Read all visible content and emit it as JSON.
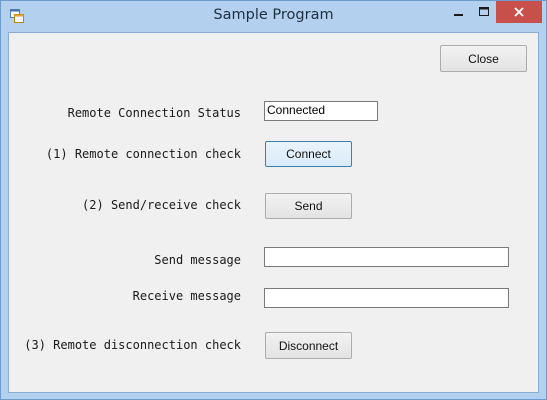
{
  "window": {
    "title": "Sample Program",
    "icon": "app-icon",
    "controls": {
      "minimize": "minimize-icon",
      "maximize": "maximize-icon",
      "close": "close-icon"
    }
  },
  "form": {
    "close_button": "Close",
    "remote_status_label": "Remote Connection Status",
    "remote_status_value": "Connected",
    "connection_check_label": "(1) Remote connection check",
    "connect_button": "Connect",
    "send_check_label": "(2) Send/receive check",
    "send_button": "Send",
    "send_message_label": "Send message",
    "send_message_value": "",
    "receive_message_label": "Receive message",
    "receive_message_value": "",
    "disconnect_check_label": "(3) Remote disconnection check",
    "disconnect_button": "Disconnect"
  },
  "colors": {
    "titlebar": "#b3d1ee",
    "close_button": "#c7504a",
    "client": "#f0f0f0"
  }
}
